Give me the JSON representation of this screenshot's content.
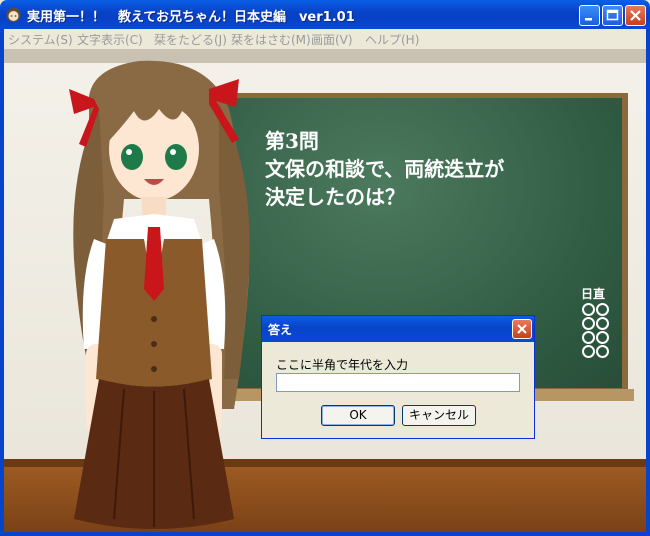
{
  "window": {
    "title": "実用第一！！　教えてお兄ちゃん！日本史編　ver1.01",
    "icon": "girl-face-icon",
    "controls": [
      "minimize-icon",
      "maximize-icon",
      "close-icon"
    ]
  },
  "menu": {
    "items": [
      {
        "label": "システム(S)"
      },
      {
        "label": "文字表示(C)"
      },
      {
        "label": "栞をたどる(J)"
      },
      {
        "label": "栞をはさむ(M)"
      },
      {
        "label": "画面(V)"
      },
      {
        "label": "ヘルプ(H)"
      }
    ]
  },
  "blackboard": {
    "question_number": "第3問",
    "question_lines": [
      "文保の和談で、両統迭立が",
      "決定したのは？"
    ],
    "score_label": "日直"
  },
  "dialog": {
    "title": "答え",
    "prompt": "ここに半角で年代を入力",
    "input_value": "",
    "ok_label": "OK",
    "cancel_label": "キャンセル"
  },
  "colors": {
    "titlebar": "#0a5fe6",
    "blackboard": "#3b6a4e",
    "floor": "#8b4a1a"
  }
}
